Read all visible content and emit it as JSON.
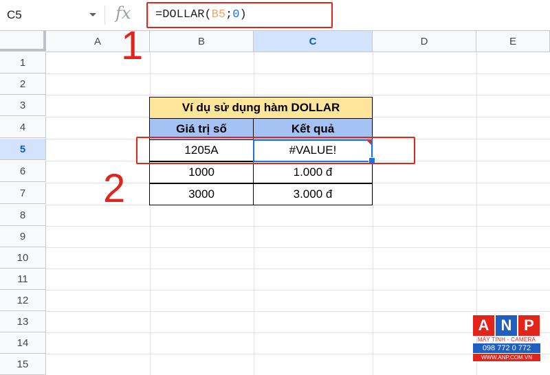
{
  "formula_bar": {
    "name_box": "C5",
    "fx_label": "fx",
    "formula_prefix": "=DOLLAR(",
    "formula_ref": "B5",
    "formula_sep": ";",
    "formula_num": "0",
    "formula_suffix": ")"
  },
  "columns": [
    "A",
    "B",
    "C",
    "D",
    "E"
  ],
  "selected_column": "C",
  "rows": [
    "1",
    "2",
    "3",
    "4",
    "5",
    "6",
    "7",
    "8",
    "9",
    "10",
    "11",
    "12",
    "13",
    "14",
    "15"
  ],
  "selected_row": "5",
  "table": {
    "title": "Ví dụ sử dụng hàm DOLLAR",
    "headers": [
      "Giá trị số",
      "Kết quả"
    ],
    "rows": [
      [
        "1205A",
        "#VALUE!"
      ],
      [
        "1000",
        "1.000 đ"
      ],
      [
        "3000",
        "3.000 đ"
      ]
    ]
  },
  "annotations": {
    "step1": "1",
    "step2": "2",
    "highlight_color": "#e3241b"
  },
  "colors": {
    "title_fill": "#ffe599",
    "header_fill": "#a4c2f4",
    "selection": "#1a73e8"
  },
  "watermark": {
    "letters": [
      "A",
      "N",
      "P"
    ],
    "letter_colors": [
      "#e3241b",
      "#1f5fbf",
      "#e3241b"
    ],
    "subtitle": "MÁY TÍNH - CAMERA",
    "phone": "098 772 0 772",
    "url": "WWW.ANP.COM.VN"
  }
}
